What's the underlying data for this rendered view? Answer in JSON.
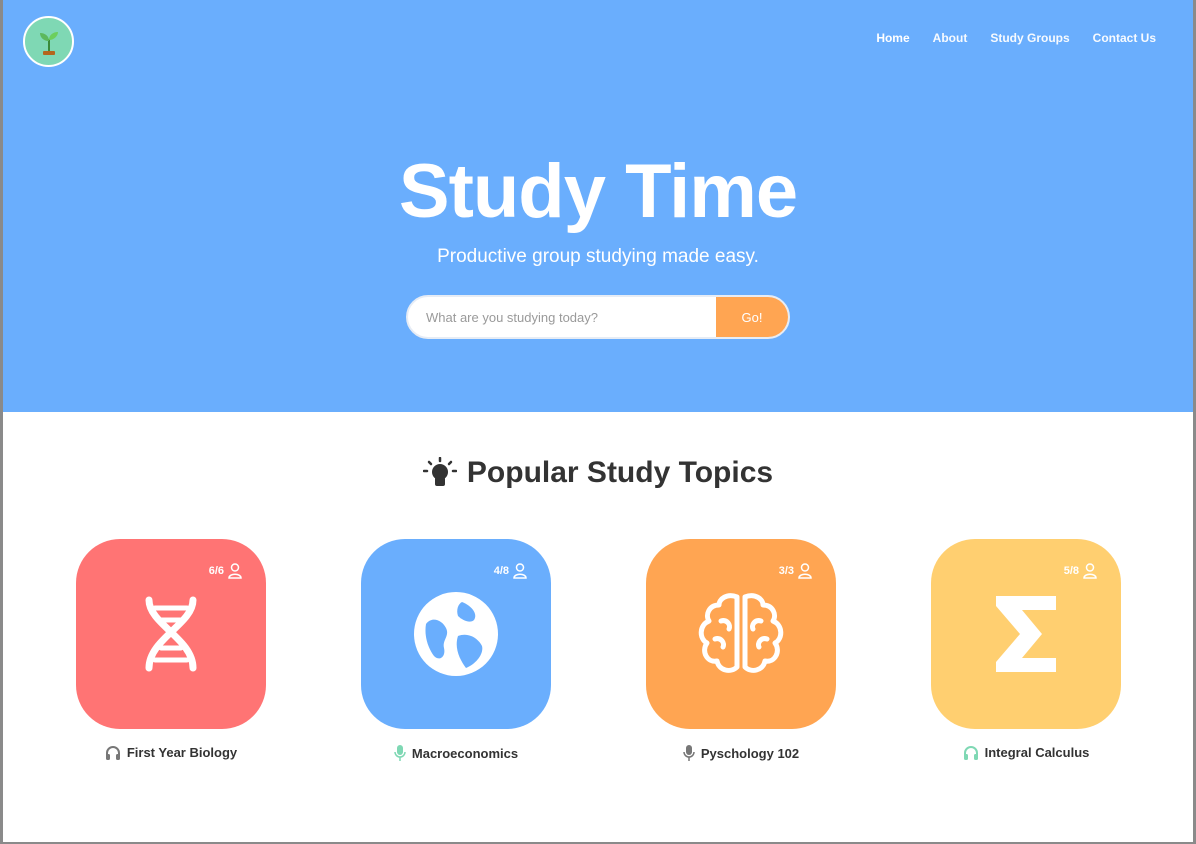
{
  "nav": {
    "items": [
      {
        "label": "Home",
        "active": true
      },
      {
        "label": "About",
        "active": false
      },
      {
        "label": "Study Groups",
        "active": false
      },
      {
        "label": "Contact Us",
        "active": false
      }
    ]
  },
  "hero": {
    "title": "Study Time",
    "subtitle": "Productive group studying made easy.",
    "search_placeholder": "What are you studying today?",
    "search_button": "Go!"
  },
  "topics_section": {
    "title": "Popular Study Topics",
    "icon": "lightbulb-icon"
  },
  "topics": [
    {
      "name": "First Year Biology",
      "count": "6/6",
      "color": "#ff7474",
      "icon": "dna-icon",
      "mode_icon": "headphones-icon",
      "mode_color": "#777777"
    },
    {
      "name": "Macroeconomics",
      "count": "4/8",
      "color": "#6aaefd",
      "icon": "globe-icon",
      "mode_icon": "microphone-icon",
      "mode_color": "#7fd8b4"
    },
    {
      "name": "Pyschology 102",
      "count": "3/3",
      "color": "#ffa552",
      "icon": "brain-icon",
      "mode_icon": "microphone-icon",
      "mode_color": "#777777"
    },
    {
      "name": "Integral Calculus",
      "count": "5/8",
      "color": "#ffcf70",
      "icon": "sigma-icon",
      "mode_icon": "headphones-icon",
      "mode_color": "#7fd8b4"
    }
  ],
  "colors": {
    "hero_bg": "#6aaefd",
    "accent_orange": "#ffa552",
    "logo_bg": "#7fd8b4",
    "text_dark": "#333333"
  }
}
